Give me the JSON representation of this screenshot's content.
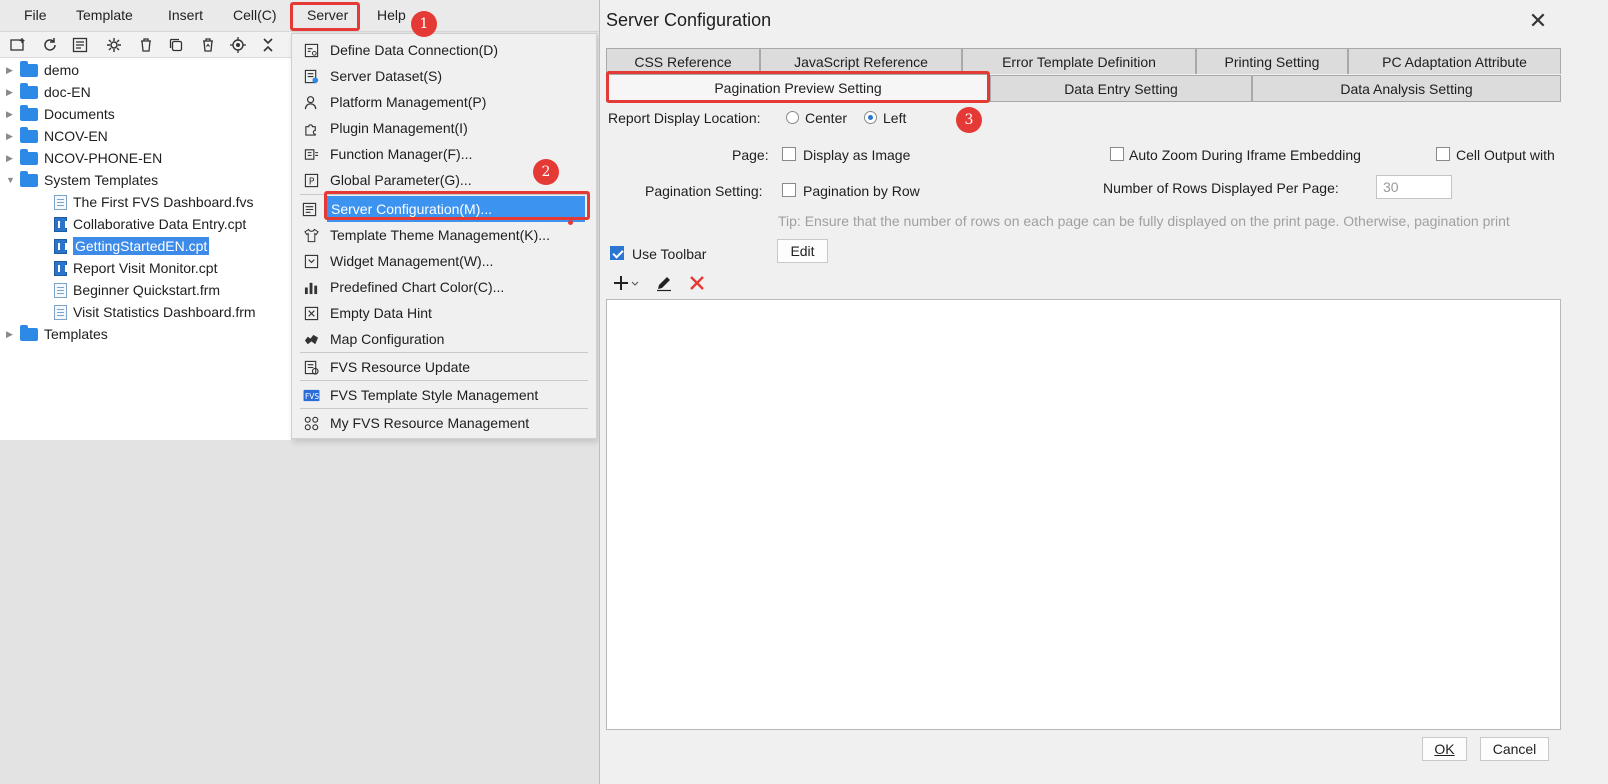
{
  "menubar": {
    "items": [
      "File",
      "Template",
      "Insert",
      "Cell(C)",
      "Server",
      "Help"
    ]
  },
  "toolbar": {
    "icons": [
      "new-folder-icon",
      "refresh-icon",
      "template-info-icon",
      "settings-icon",
      "delete-icon",
      "copy-icon",
      "recycle-icon",
      "locate-icon",
      "collapse-icon"
    ]
  },
  "tree": {
    "items": [
      {
        "label": "demo",
        "type": "folder"
      },
      {
        "label": "doc-EN",
        "type": "folder"
      },
      {
        "label": "Documents",
        "type": "folder"
      },
      {
        "label": "NCOV-EN",
        "type": "folder"
      },
      {
        "label": "NCOV-PHONE-EN",
        "type": "folder"
      },
      {
        "label": "System Templates",
        "type": "folder",
        "expanded": true
      },
      {
        "label": "The First FVS Dashboard.fvs",
        "type": "fvs"
      },
      {
        "label": "Collaborative Data Entry.cpt",
        "type": "cpt"
      },
      {
        "label": "GettingStartedEN.cpt",
        "type": "cpt",
        "selected": true
      },
      {
        "label": "Report Visit Monitor.cpt",
        "type": "cpt"
      },
      {
        "label": "Beginner Quickstart.frm",
        "type": "frm"
      },
      {
        "label": "Visit Statistics Dashboard.frm",
        "type": "frm"
      },
      {
        "label": "Templates",
        "type": "folder"
      }
    ]
  },
  "server_menu": {
    "items": [
      {
        "label": "Define Data Connection(D)",
        "icon": "data-connection-icon"
      },
      {
        "label": "Server Dataset(S)",
        "icon": "server-dataset-icon"
      },
      {
        "label": "Platform Management(P)",
        "icon": "platform-user-icon"
      },
      {
        "label": "Plugin Management(I)",
        "icon": "plugin-icon"
      },
      {
        "label": "Function Manager(F)...",
        "icon": "function-icon"
      },
      {
        "label": "Global Parameter(G)...",
        "icon": "parameter-icon"
      },
      {
        "label": "Server Configuration(M)...",
        "icon": "server-config-icon",
        "highlighted": true
      },
      {
        "label": "Template Theme Management(K)...",
        "icon": "theme-shirt-icon"
      },
      {
        "label": "Widget Management(W)...",
        "icon": "widget-icon"
      },
      {
        "label": "Predefined Chart Color(C)...",
        "icon": "chart-color-icon"
      },
      {
        "label": "Empty Data Hint",
        "icon": "empty-data-icon"
      },
      {
        "label": "Map Configuration",
        "icon": "map-icon"
      },
      {
        "label": "FVS Resource Update",
        "icon": "fvs-update-icon"
      },
      {
        "label": "FVS Template Style Management",
        "icon": "fvs-style-icon"
      },
      {
        "label": "My FVS Resource Management",
        "icon": "fvs-resource-icon"
      }
    ]
  },
  "callouts": {
    "one": "1",
    "two": "2",
    "three": "3"
  },
  "dialog": {
    "title": "Server Configuration",
    "close": "✕",
    "tabs_row1": [
      "CSS Reference",
      "JavaScript Reference",
      "Error Template Definition",
      "Printing Setting",
      "PC Adaptation Attribute"
    ],
    "tabs_row2": [
      "Pagination Preview Setting",
      "Data Entry Setting",
      "Data Analysis Setting"
    ],
    "active_tab": "Pagination Preview Setting",
    "report_display_location": {
      "label": "Report Display Location:",
      "options": [
        "Center",
        "Left"
      ],
      "selected": "Left"
    },
    "page": {
      "label": "Page:",
      "display_as_image": "Display as Image",
      "auto_zoom": "Auto Zoom During Iframe Embedding",
      "cell_output": "Cell Output with"
    },
    "pagination": {
      "label": "Pagination Setting:",
      "by_row": "Pagination by Row",
      "rows_label": "Number of Rows Displayed Per Page:",
      "rows_value": "30"
    },
    "tip": "Tip: Ensure that the number of rows on each page can be fully displayed on the print page. Otherwise, pagination print",
    "use_toolbar": {
      "label": "Use Toolbar",
      "checked": true
    },
    "edit_button": "Edit",
    "list_actions": [
      "add-icon",
      "edit-pencil-icon",
      "delete-x-icon"
    ],
    "ok": "OK",
    "cancel": "Cancel"
  },
  "colors": {
    "accent": "#3d94f0",
    "callout": "#e53935",
    "checkbox": "#2a76d2"
  }
}
